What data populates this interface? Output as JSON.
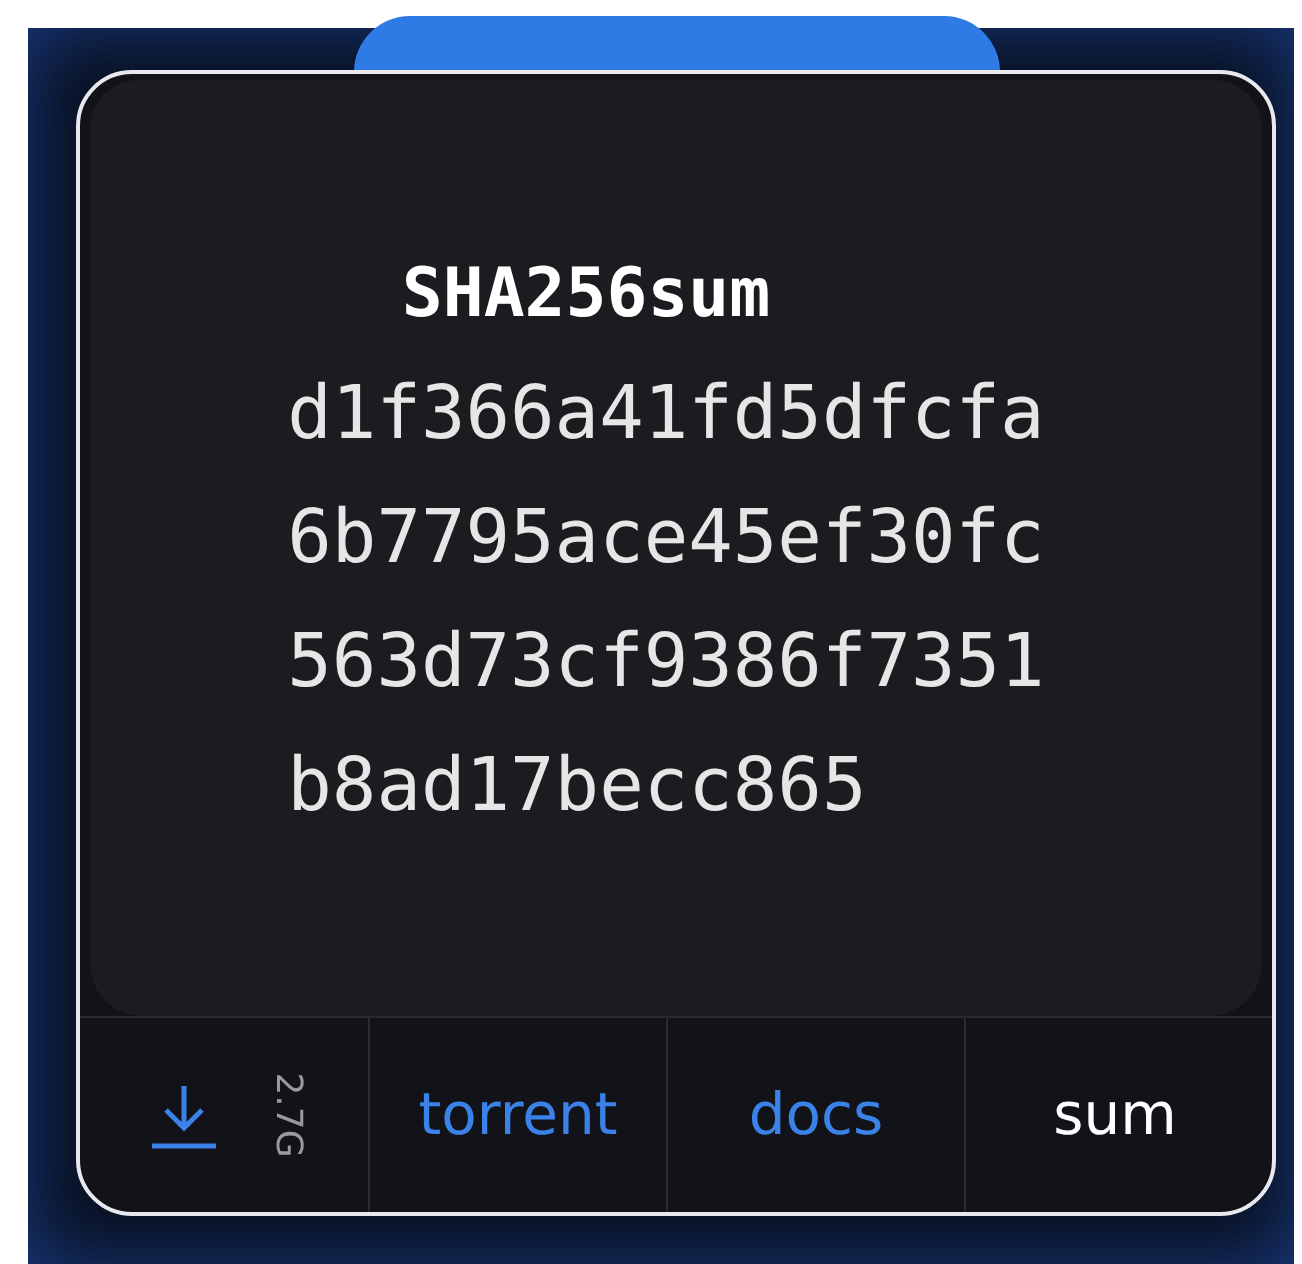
{
  "hash": {
    "title": "SHA256sum",
    "lines": [
      "d1f366a41fd5dfcfa",
      "6b7795ace45ef30fc",
      "563d73cf9386f7351",
      "b8ad17becc865"
    ]
  },
  "download": {
    "size": "2.7G"
  },
  "tabs": [
    {
      "label": "torrent",
      "selected": false
    },
    {
      "label": "docs",
      "selected": false
    },
    {
      "label": "sum",
      "selected": true
    }
  ]
}
